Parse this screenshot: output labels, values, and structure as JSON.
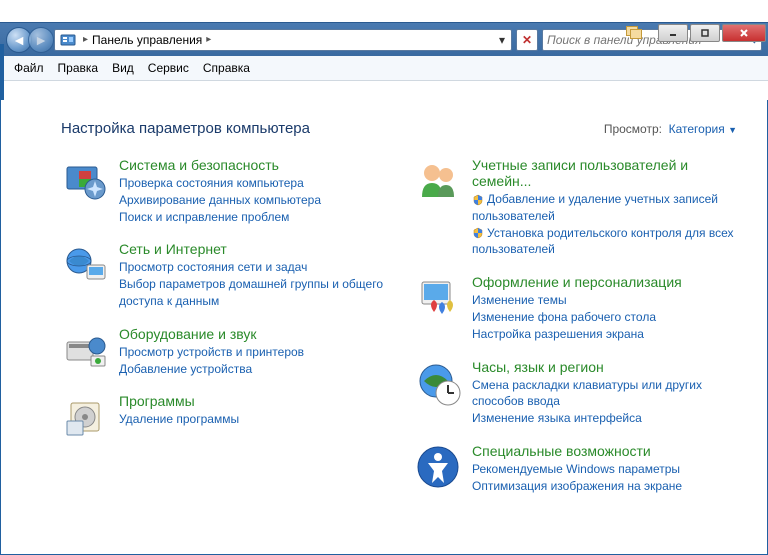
{
  "window": {
    "address_label": "Панель управления",
    "search_placeholder": "Поиск в панели управления"
  },
  "menu": {
    "file": "Файл",
    "edit": "Правка",
    "view": "Вид",
    "tools": "Сервис",
    "help": "Справка"
  },
  "header": {
    "title": "Настройка параметров компьютера",
    "view_label": "Просмотр:",
    "view_value": "Категория"
  },
  "left_col": [
    {
      "title": "Система и безопасность",
      "links": [
        "Проверка состояния компьютера",
        "Архивирование данных компьютера",
        "Поиск и исправление проблем"
      ],
      "icon": "security"
    },
    {
      "title": "Сеть и Интернет",
      "links": [
        "Просмотр состояния сети и задач",
        "Выбор параметров домашней группы и общего доступа к данным"
      ],
      "icon": "network"
    },
    {
      "title": "Оборудование и звук",
      "links": [
        "Просмотр устройств и принтеров",
        "Добавление устройства"
      ],
      "icon": "hardware"
    },
    {
      "title": "Программы",
      "links": [
        "Удаление программы"
      ],
      "icon": "programs"
    }
  ],
  "right_col": [
    {
      "title": "Учетные записи пользователей и семейн...",
      "links": [
        {
          "text": "Добавление и удаление учетных записей пользователей",
          "shield": true
        },
        {
          "text": "Установка родительского контроля для всех пользователей",
          "shield": true
        }
      ],
      "icon": "users"
    },
    {
      "title": "Оформление и персонализация",
      "links": [
        "Изменение темы",
        "Изменение фона рабочего стола",
        "Настройка разрешения экрана"
      ],
      "icon": "appearance"
    },
    {
      "title": "Часы, язык и регион",
      "links": [
        "Смена раскладки клавиатуры или других способов ввода",
        "Изменение языка интерфейса"
      ],
      "icon": "clock"
    },
    {
      "title": "Специальные возможности",
      "links": [
        "Рекомендуемые Windows параметры",
        "Оптимизация изображения на экране"
      ],
      "icon": "access"
    }
  ]
}
